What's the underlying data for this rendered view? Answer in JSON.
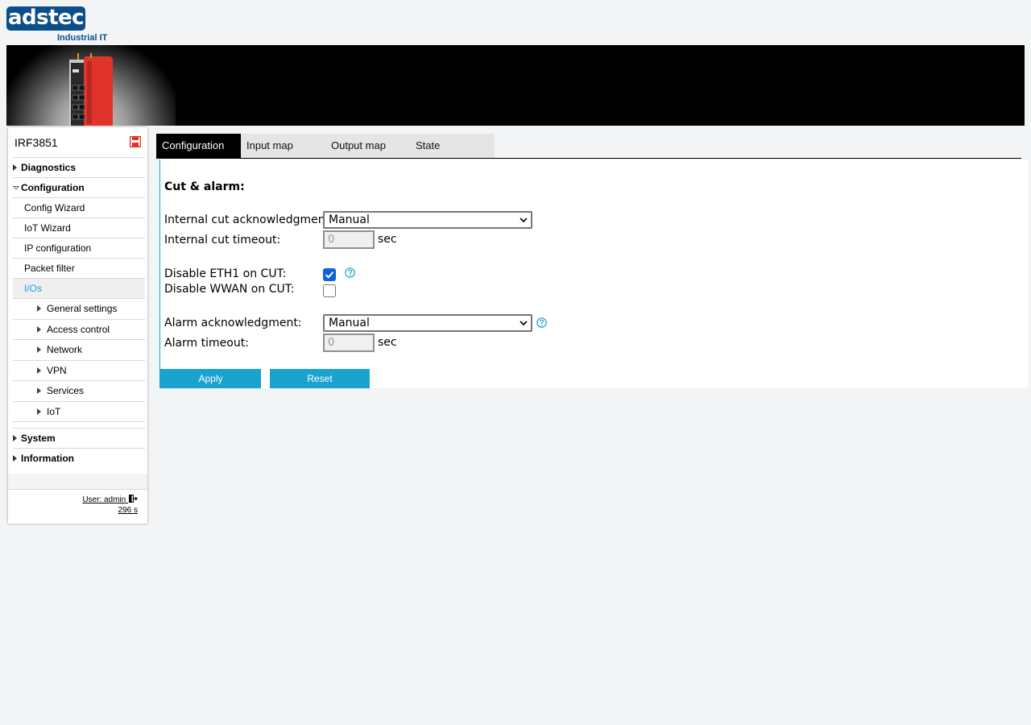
{
  "brand": {
    "logo_text": "adstec",
    "logo_subtitle": "Industrial IT"
  },
  "sidebar": {
    "device_name": "IRF3851",
    "items": [
      {
        "label": "Diagnostics",
        "level": 0,
        "expanded": false
      },
      {
        "label": "Configuration",
        "level": 0,
        "expanded": true
      },
      {
        "label": "Config Wizard",
        "level": 1
      },
      {
        "label": "IoT Wizard",
        "level": 1
      },
      {
        "label": "IP configuration",
        "level": 1
      },
      {
        "label": "Packet filter",
        "level": 1
      },
      {
        "label": "I/Os",
        "level": 1,
        "active": true
      },
      {
        "label": "General settings",
        "level": 2
      },
      {
        "label": "Access control",
        "level": 2
      },
      {
        "label": "Network",
        "level": 2
      },
      {
        "label": "VPN",
        "level": 2
      },
      {
        "label": "Services",
        "level": 2
      },
      {
        "label": "IoT",
        "level": 2
      },
      {
        "label": "System",
        "level": 0,
        "expanded": false
      },
      {
        "label": "Information",
        "level": 0,
        "expanded": false
      }
    ],
    "user_label": "User: admin",
    "session_time": "296 s"
  },
  "tabs": [
    {
      "label": "Configuration",
      "active": true
    },
    {
      "label": "Input map",
      "active": false
    },
    {
      "label": "Output map",
      "active": false
    },
    {
      "label": "State",
      "active": false
    }
  ],
  "form": {
    "section_title": "Cut & alarm:",
    "internal_cut_ack_label": "Internal cut acknowledgment",
    "internal_cut_ack_value": "Manual",
    "internal_cut_timeout_label": "Internal cut timeout:",
    "internal_cut_timeout_value": "0",
    "disable_eth1_label": "Disable ETH1 on CUT:",
    "disable_eth1_checked": true,
    "disable_wwan_label": "Disable WWAN on CUT:",
    "disable_wwan_checked": false,
    "alarm_ack_label": "Alarm acknowledgment:",
    "alarm_ack_value": "Manual",
    "alarm_timeout_label": "Alarm timeout:",
    "alarm_timeout_value": "0",
    "unit": "sec",
    "apply_label": "Apply",
    "reset_label": "Reset"
  },
  "colors": {
    "accent": "#1aa3cf",
    "brand_blue": "#0b4f8a",
    "device_red": "#e0342b",
    "checkbox_blue": "#0a63d9"
  }
}
